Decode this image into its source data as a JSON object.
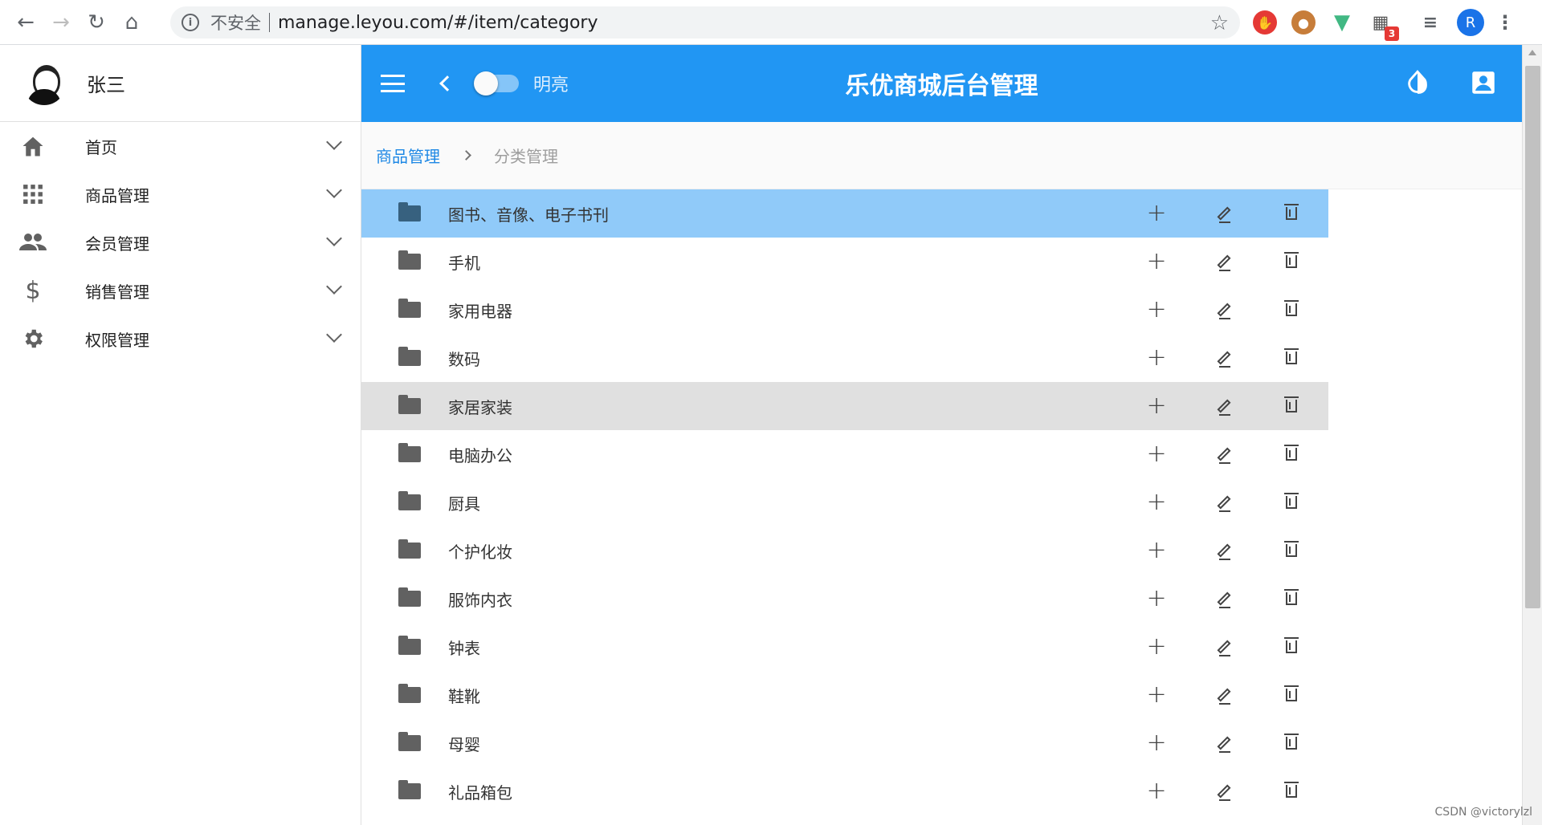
{
  "browser": {
    "insecure_label": "不安全",
    "url": "manage.leyou.com/#/item/category",
    "profile_initial": "R",
    "ext_badge": "3"
  },
  "sidebar": {
    "user_name": "张三",
    "items": [
      {
        "label": "首页",
        "icon": "home-icon"
      },
      {
        "label": "商品管理",
        "icon": "apps-grid-icon"
      },
      {
        "label": "会员管理",
        "icon": "people-icon"
      },
      {
        "label": "销售管理",
        "icon": "dollar-icon"
      },
      {
        "label": "权限管理",
        "icon": "gear-icon"
      }
    ]
  },
  "topbar": {
    "theme_label": "明亮",
    "title": "乐优商城后台管理"
  },
  "breadcrumb": {
    "parent": "商品管理",
    "current": "分类管理"
  },
  "categories": [
    {
      "label": "图书、音像、电子书刊",
      "state": "selected"
    },
    {
      "label": "手机",
      "state": ""
    },
    {
      "label": "家用电器",
      "state": ""
    },
    {
      "label": "数码",
      "state": ""
    },
    {
      "label": "家居家装",
      "state": "hover"
    },
    {
      "label": "电脑办公",
      "state": ""
    },
    {
      "label": "厨具",
      "state": ""
    },
    {
      "label": "个护化妆",
      "state": ""
    },
    {
      "label": "服饰内衣",
      "state": ""
    },
    {
      "label": "钟表",
      "state": ""
    },
    {
      "label": "鞋靴",
      "state": ""
    },
    {
      "label": "母婴",
      "state": ""
    },
    {
      "label": "礼品箱包",
      "state": ""
    }
  ],
  "watermark": "CSDN @victorylzl",
  "colors": {
    "primary": "#2196f3",
    "selected_row": "#90caf9",
    "hover_row": "#e0e0e0"
  }
}
